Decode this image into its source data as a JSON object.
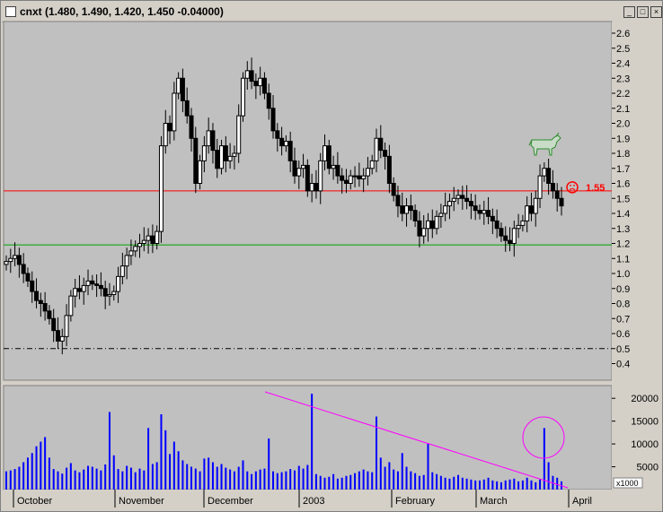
{
  "window": {
    "title": "cnxt (1.480, 1.490, 1.420, 1.450 -0.04000)",
    "minimize_icon": "minimize-icon",
    "maximize_icon": "maximize-icon",
    "close_icon": "close-icon"
  },
  "price_axis": {
    "ticks": [
      "2.6",
      "2.5",
      "2.4",
      "2.3",
      "2.2",
      "2.1",
      "2.0",
      "1.9",
      "1.8",
      "1.7",
      "1.6",
      "1.5",
      "1.4",
      "1.3",
      "1.2",
      "1.1",
      "1.0",
      "0.9",
      "0.8",
      "0.7",
      "0.6",
      "0.5",
      "0.4"
    ]
  },
  "volume_axis": {
    "ticks": [
      "20000",
      "15000",
      "10000",
      "5000"
    ],
    "unit": "x1000"
  },
  "time_axis": {
    "labels": [
      "October",
      "November",
      "December",
      "2003",
      "February",
      "March",
      "April"
    ]
  },
  "annotations": {
    "resistance_label": "1.55",
    "resistance_color": "#ff0000",
    "support_color": "#00a000",
    "dashdot_color": "#000000",
    "trend_color": "#ff00ff",
    "bull_icon": "bull-icon",
    "frown_icon": "frown-icon"
  },
  "chart_data": [
    {
      "type": "candlestick",
      "title": "cnxt (1.480, 1.490, 1.420, 1.450 -0.04000)",
      "ylim": [
        0.35,
        2.7
      ],
      "grid": false,
      "horizontal_lines": [
        {
          "value": 1.55,
          "color": "#ff0000"
        },
        {
          "value": 1.19,
          "color": "#00a000"
        },
        {
          "value": 0.5,
          "color": "#000000",
          "style": "dash-dot"
        }
      ],
      "last_close": 1.45,
      "closes": [
        1.08,
        1.1,
        1.12,
        1.06,
        1.0,
        0.95,
        0.88,
        0.82,
        0.8,
        0.75,
        0.7,
        0.62,
        0.55,
        0.58,
        0.72,
        0.85,
        0.9,
        0.88,
        0.92,
        0.95,
        0.93,
        0.92,
        0.9,
        0.85,
        0.86,
        0.88,
        0.98,
        1.05,
        1.12,
        1.15,
        1.18,
        1.2,
        1.22,
        1.25,
        1.2,
        1.28,
        1.85,
        2.0,
        1.95,
        2.2,
        2.3,
        2.15,
        2.05,
        1.9,
        1.6,
        1.75,
        1.85,
        1.95,
        1.82,
        1.7,
        1.85,
        1.75,
        1.78,
        1.8,
        2.05,
        2.3,
        2.35,
        2.28,
        2.25,
        2.3,
        2.2,
        2.1,
        1.95,
        1.9,
        1.85,
        1.88,
        1.75,
        1.65,
        1.7,
        1.72,
        1.55,
        1.6,
        1.55,
        1.75,
        1.85,
        1.7,
        1.72,
        1.65,
        1.62,
        1.6,
        1.65,
        1.65,
        1.63,
        1.65,
        1.7,
        1.75,
        1.9,
        1.82,
        1.78,
        1.6,
        1.52,
        1.45,
        1.4,
        1.45,
        1.42,
        1.35,
        1.25,
        1.3,
        1.35,
        1.3,
        1.38,
        1.4,
        1.45,
        1.48,
        1.5,
        1.52,
        1.5,
        1.48,
        1.45,
        1.42,
        1.4,
        1.42,
        1.38,
        1.35,
        1.3,
        1.25,
        1.22,
        1.2,
        1.3,
        1.32,
        1.35,
        1.45,
        1.4,
        1.5,
        1.65,
        1.7,
        1.6,
        1.55,
        1.5,
        1.45
      ],
      "volume_ylim": [
        0,
        22000
      ],
      "volume": [
        4000,
        4200,
        4500,
        5000,
        6000,
        7000,
        8000,
        9500,
        10500,
        11500,
        7000,
        4500,
        4000,
        3500,
        4800,
        5800,
        4200,
        3800,
        4400,
        5200,
        5000,
        4600,
        4200,
        5500,
        17000,
        7500,
        4500,
        4000,
        5200,
        4800,
        3800,
        4600,
        4200,
        13500,
        5600,
        6000,
        16500,
        13000,
        7800,
        10500,
        8400,
        6400,
        5600,
        5000,
        4600,
        4000,
        6800,
        7000,
        6000,
        5000,
        5600,
        4800,
        4400,
        4000,
        5000,
        6400,
        4000,
        3400,
        4000,
        4400,
        4600,
        11200,
        4000,
        3600,
        3800,
        4000,
        4500,
        4200,
        5200,
        4600,
        5400,
        21000,
        3400,
        3000,
        2600,
        2800,
        3400,
        2400,
        2600,
        3000,
        3200,
        3600,
        4000,
        4400,
        4000,
        3800,
        16000,
        7000,
        5000,
        6000,
        4400,
        4000,
        8000,
        5000,
        4000,
        3600,
        3000,
        3200,
        10000,
        3800,
        3400,
        3000,
        2600,
        2400,
        2800,
        3200,
        2600,
        2400,
        2200,
        2000,
        2000,
        2200,
        2600,
        2000,
        1800,
        1600,
        2000,
        2200,
        2400,
        1800,
        2000,
        2600,
        2000,
        1600,
        2200,
        13500,
        6000,
        3000,
        2600,
        1800
      ]
    }
  ]
}
